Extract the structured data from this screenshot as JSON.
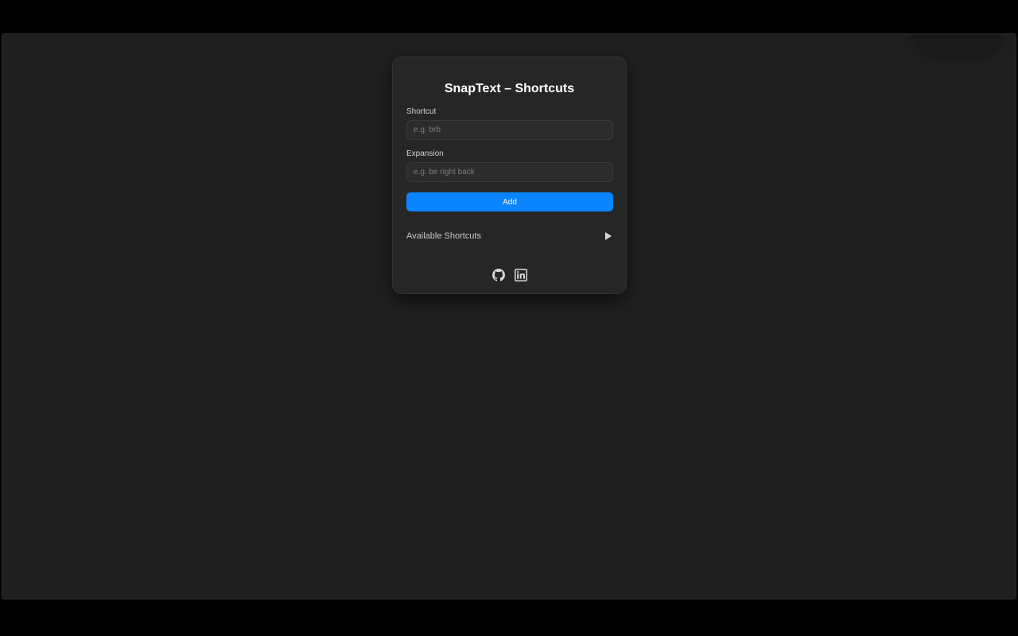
{
  "app": {
    "title": "SnapText – Shortcuts"
  },
  "form": {
    "shortcut_label": "Shortcut",
    "shortcut_value": "",
    "shortcut_placeholder": "e.g. brb",
    "expansion_label": "Expansion",
    "expansion_value": "",
    "expansion_placeholder": "e.g. be right back",
    "add_label": "Add"
  },
  "shortcuts_section": {
    "label": "Available Shortcuts",
    "expanded": false,
    "toggle_icon": "play-arrow-icon"
  },
  "socials": [
    {
      "icon": "github-icon"
    },
    {
      "icon": "linkedin-icon"
    }
  ],
  "colors": {
    "accent": "#0a84ff",
    "background": "#1f1f1f",
    "card": "#262626",
    "text": "#ffffff"
  }
}
